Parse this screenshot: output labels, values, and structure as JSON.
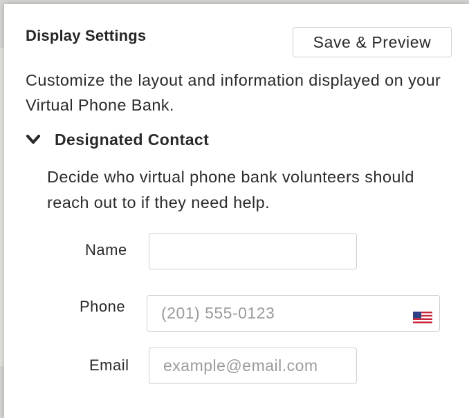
{
  "panel": {
    "title": "Display Settings",
    "save_label": "Save & Preview",
    "description": "Customize the layout and information displayed on your Virtual Phone Bank."
  },
  "section": {
    "icon": "chevron-down-icon",
    "title": "Designated Contact",
    "description": "Decide who virtual phone bank volunteers should reach out to if they need help.",
    "fields": {
      "name": {
        "label": "Name",
        "value": "",
        "placeholder": ""
      },
      "phone": {
        "label": "Phone",
        "value": "",
        "placeholder": "(201) 555-0123",
        "country_icon": "us-flag-icon"
      },
      "email": {
        "label": "Email",
        "value": "",
        "placeholder": "example@email.com"
      }
    }
  }
}
